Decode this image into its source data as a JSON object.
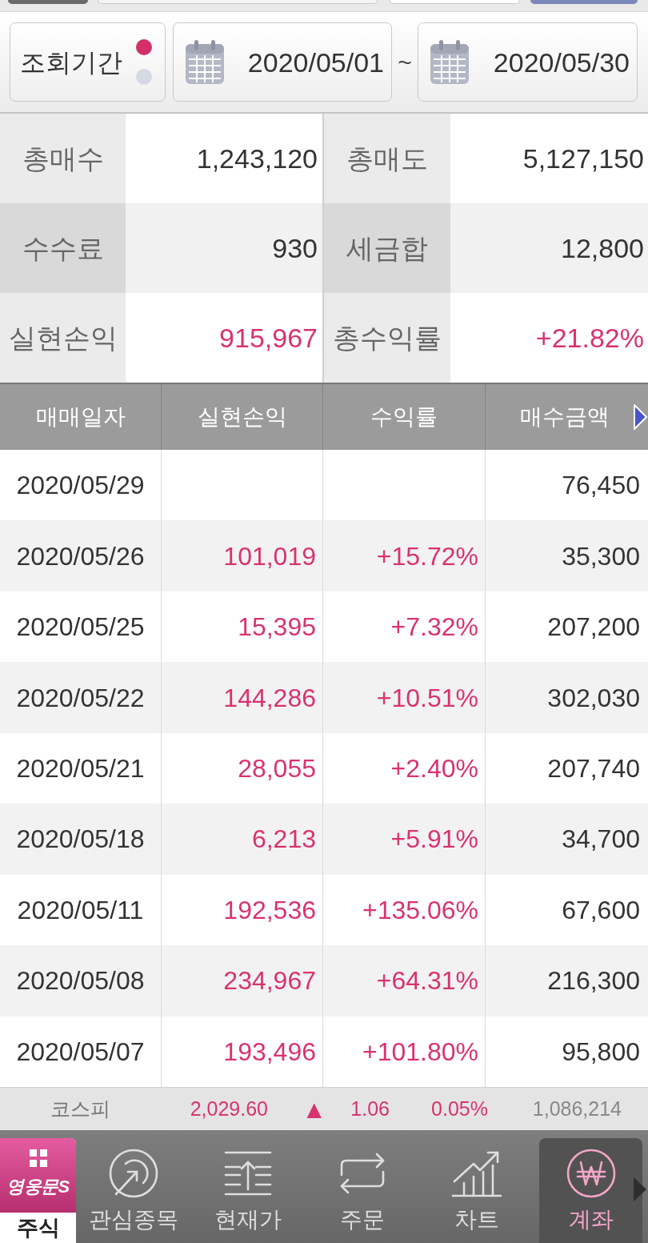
{
  "period": {
    "label": "조회기간",
    "indicators": [
      {
        "selected": true
      },
      {
        "selected": false
      }
    ],
    "start_date": "2020/05/01",
    "separator": "~",
    "end_date": "2020/05/30"
  },
  "summary": [
    [
      {
        "label": "총매수",
        "value": "1,243,120",
        "kind": "amount"
      },
      {
        "label": "총매도",
        "value": "5,127,150",
        "kind": "amount"
      }
    ],
    [
      {
        "label": "수수료",
        "value": "930",
        "kind": "amount"
      },
      {
        "label": "세금합",
        "value": "12,800",
        "kind": "amount"
      }
    ],
    [
      {
        "label": "실현손익",
        "value": "915,967",
        "kind": "profit"
      },
      {
        "label": "총수익률",
        "value": "+21.82%",
        "kind": "profit"
      }
    ]
  ],
  "table": {
    "columns": [
      "매매일자",
      "실현손익",
      "수익률",
      "매수금액"
    ],
    "rows": [
      {
        "date": "2020/05/29",
        "buy_amount": "76,450"
      },
      {
        "date": "2020/05/26",
        "realized_pl": "101,019",
        "return_rate": "+15.72%",
        "buy_amount": "35,300"
      },
      {
        "date": "2020/05/25",
        "realized_pl": "15,395",
        "return_rate": "+7.32%",
        "buy_amount": "207,200"
      },
      {
        "date": "2020/05/22",
        "realized_pl": "144,286",
        "return_rate": "+10.51%",
        "buy_amount": "302,030"
      },
      {
        "date": "2020/05/21",
        "realized_pl": "28,055",
        "return_rate": "+2.40%",
        "buy_amount": "207,740"
      },
      {
        "date": "2020/05/18",
        "realized_pl": "6,213",
        "return_rate": "+5.91%",
        "buy_amount": "34,700"
      },
      {
        "date": "2020/05/11",
        "realized_pl": "192,536",
        "return_rate": "+135.06%",
        "buy_amount": "67,600"
      },
      {
        "date": "2020/05/08",
        "realized_pl": "234,967",
        "return_rate": "+64.31%",
        "buy_amount": "216,300"
      },
      {
        "date": "2020/05/07",
        "realized_pl": "193,496",
        "return_rate": "+101.80%",
        "buy_amount": "95,800"
      }
    ]
  },
  "ticker": {
    "index": "코스피",
    "price": "2,029.60",
    "rising": true,
    "arrow": "▲",
    "change": "1.06",
    "change_rate": "0.05%",
    "volume": "1,086,214"
  },
  "nav": {
    "menu": {
      "logo": "영웅문S",
      "label": "주식"
    },
    "items": [
      {
        "kind": "watchlist",
        "label": "관심종목",
        "selected": false
      },
      {
        "kind": "quote",
        "label": "현재가",
        "selected": false
      },
      {
        "kind": "order",
        "label": "주문",
        "selected": false
      },
      {
        "kind": "chart",
        "label": "차트",
        "selected": false
      },
      {
        "kind": "account",
        "label": "계좌",
        "selected": true
      }
    ]
  }
}
